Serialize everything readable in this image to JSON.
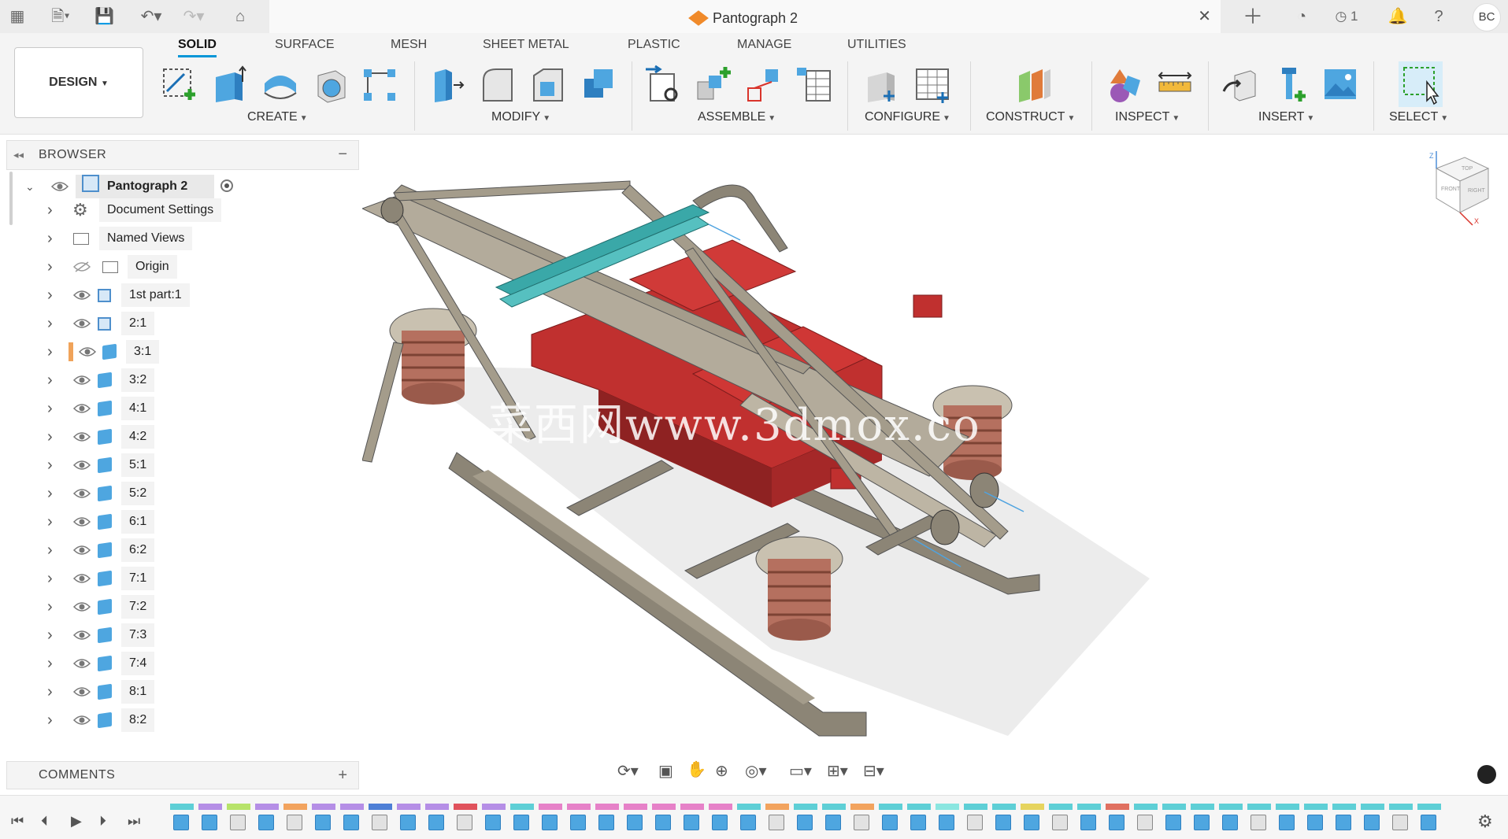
{
  "titlebar": {
    "document_title": "Pantograph 2",
    "jobs_count": "1",
    "user_initials": "BC"
  },
  "ribbon": {
    "design_label": "DESIGN",
    "tabs": [
      "SOLID",
      "SURFACE",
      "MESH",
      "SHEET METAL",
      "PLASTIC",
      "MANAGE",
      "UTILITIES"
    ],
    "active_tab": "SOLID",
    "groups": [
      "CREATE",
      "MODIFY",
      "ASSEMBLE",
      "CONFIGURE",
      "CONSTRUCT",
      "INSPECT",
      "INSERT",
      "SELECT"
    ]
  },
  "browser": {
    "title": "BROWSER",
    "root": "Pantograph 2",
    "items": [
      {
        "label": "Document Settings",
        "icon": "gear-icon"
      },
      {
        "label": "Named Views",
        "icon": "folder-icon"
      },
      {
        "label": "Origin",
        "icon": "folder-icon",
        "hidden": true
      },
      {
        "label": "1st part:1",
        "icon": "component-icon"
      },
      {
        "label": "2:1",
        "icon": "component-icon"
      },
      {
        "label": "3:1",
        "icon": "body-icon",
        "highlighted": true
      },
      {
        "label": "3:2",
        "icon": "body-icon"
      },
      {
        "label": "4:1",
        "icon": "body-icon"
      },
      {
        "label": "4:2",
        "icon": "body-icon"
      },
      {
        "label": "5:1",
        "icon": "body-icon"
      },
      {
        "label": "5:2",
        "icon": "body-icon"
      },
      {
        "label": "6:1",
        "icon": "body-icon"
      },
      {
        "label": "6:2",
        "icon": "body-icon"
      },
      {
        "label": "7:1",
        "icon": "body-icon"
      },
      {
        "label": "7:2",
        "icon": "body-icon"
      },
      {
        "label": "7:3",
        "icon": "body-icon"
      },
      {
        "label": "7:4",
        "icon": "body-icon"
      },
      {
        "label": "8:1",
        "icon": "body-icon"
      },
      {
        "label": "8:2",
        "icon": "body-icon"
      }
    ]
  },
  "comments": {
    "title": "COMMENTS"
  },
  "viewport": {
    "watermark": "菜西网www.3dmox.co",
    "viewcube_faces": [
      "TOP",
      "FRONT",
      "RIGHT"
    ],
    "axes": [
      "Z",
      "X"
    ]
  },
  "colors": {
    "accent": "#0696d7",
    "body_red": "#c0302f",
    "frame_grey": "#a09a8d",
    "insulator": "#b5705f",
    "cyan_rail": "#3aa8a8"
  }
}
